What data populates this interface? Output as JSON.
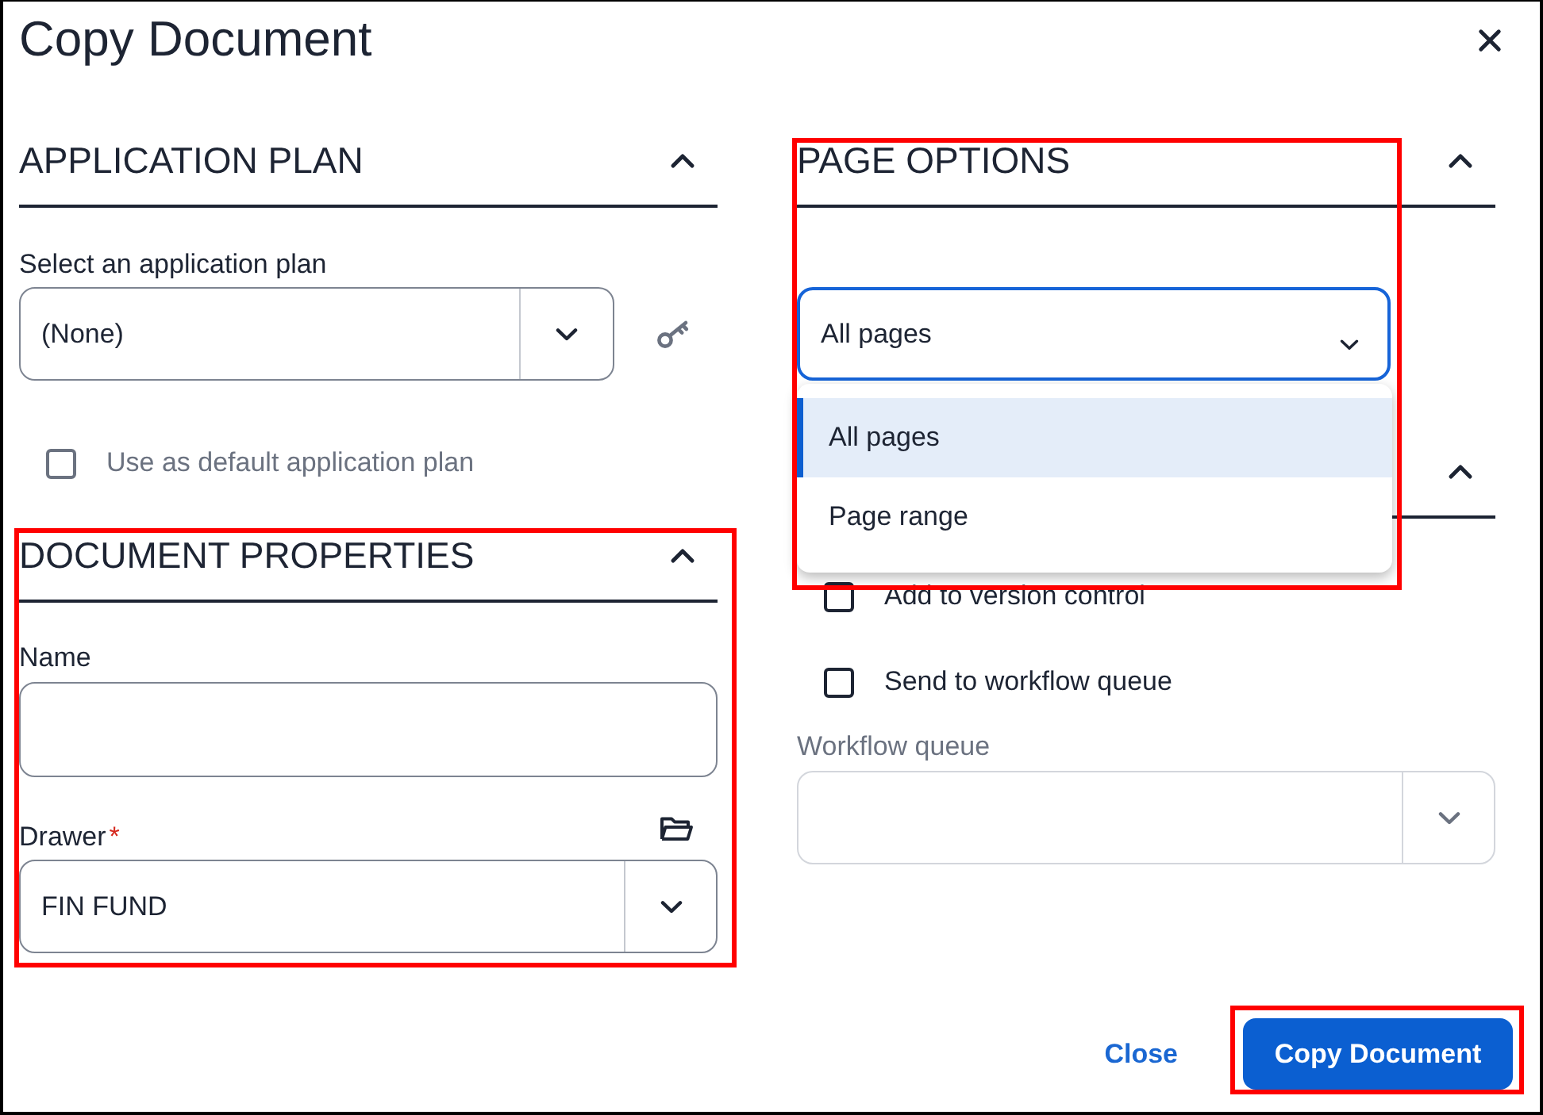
{
  "dialog": {
    "title": "Copy Document"
  },
  "application_plan": {
    "title": "APPLICATION PLAN",
    "expanded": true,
    "plan_field": {
      "label": "Select an application plan",
      "value": "(None)"
    },
    "default_checkbox": {
      "label": "Use as default application plan",
      "checked": false,
      "disabled": true
    }
  },
  "document_properties": {
    "title": "DOCUMENT PROPERTIES",
    "expanded": true,
    "highlighted": true,
    "name_field": {
      "label": "Name"
    },
    "drawer_field": {
      "label": "Drawer",
      "required_mark": "*",
      "value": "FIN FUND"
    }
  },
  "page_options": {
    "title": "PAGE OPTIONS",
    "expanded": true,
    "highlighted": true,
    "page_select": {
      "value": "All pages",
      "focused": true,
      "open": true,
      "options": [
        {
          "label": "All pages",
          "selected": true
        },
        {
          "label": "Page range",
          "selected": false
        }
      ]
    }
  },
  "section_3": {
    "expanded": true,
    "checkboxes": [
      {
        "label": "Add to version control",
        "checked": false
      },
      {
        "label": "Send to workflow queue",
        "checked": false
      }
    ],
    "workflow_queue": {
      "label": "Workflow queue",
      "disabled": true
    }
  },
  "footer": {
    "buttons": [
      {
        "label": "Close",
        "kind": "link"
      },
      {
        "label": "Copy Document",
        "kind": "primary",
        "highlighted": true
      }
    ]
  }
}
